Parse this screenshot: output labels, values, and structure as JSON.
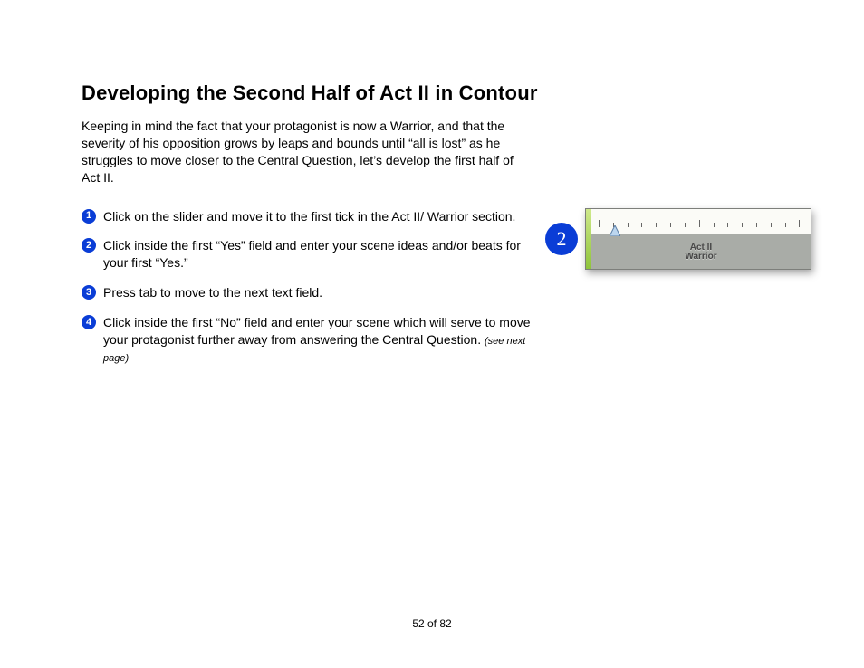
{
  "heading": "Developing the Second Half of Act II in Contour",
  "intro": "Keeping in mind the fact that your protagonist is now a Warrior, and that the severity of his opposition grows by leaps and bounds until “all is lost” as he struggles to move closer to the Central Question, let’s develop the first half of Act II.",
  "steps": [
    {
      "n": "1",
      "text": "Click on the slider and move it to the first tick in the Act II/ Warrior section."
    },
    {
      "n": "2",
      "text": "Click inside the first “Yes” field and enter your scene ideas and/or beats for your first “Yes.”"
    },
    {
      "n": "3",
      "text": "Press tab to move to the next text field."
    },
    {
      "n": "4",
      "text": "Click inside the first “No” field and enter your scene which will serve to move your protagonist further away from answering the Central Question.",
      "hint": "(see next page)"
    }
  ],
  "callout": {
    "bullet": "2",
    "label_top": "Act II",
    "label_bottom": "Warrior"
  },
  "page_number": "52 of 82"
}
